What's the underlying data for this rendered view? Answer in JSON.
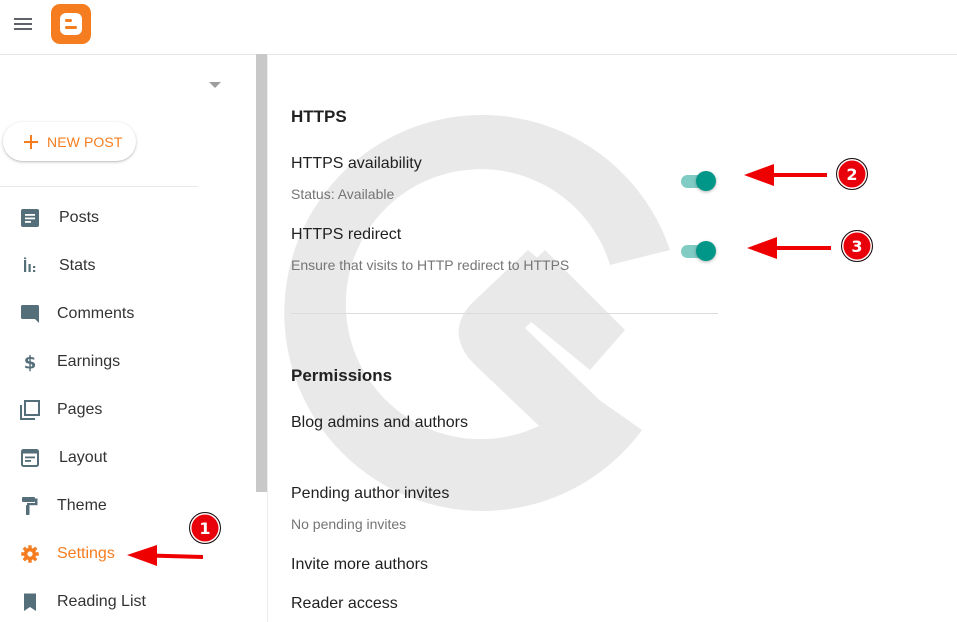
{
  "header": {
    "menu_icon": "hamburger-menu-icon",
    "logo": "blogger-logo",
    "brand_color": "#f57d1f"
  },
  "sidebar": {
    "blog_selector_icon": "caret-down-icon",
    "new_post_label": "NEW POST",
    "items": [
      {
        "label": "Posts",
        "icon": "posts-icon",
        "active": false
      },
      {
        "label": "Stats",
        "icon": "stats-icon",
        "active": false
      },
      {
        "label": "Comments",
        "icon": "comments-icon",
        "active": false
      },
      {
        "label": "Earnings",
        "icon": "dollar-icon",
        "active": false
      },
      {
        "label": "Pages",
        "icon": "pages-icon",
        "active": false
      },
      {
        "label": "Layout",
        "icon": "layout-icon",
        "active": false
      },
      {
        "label": "Theme",
        "icon": "paint-roller-icon",
        "active": false
      },
      {
        "label": "Settings",
        "icon": "gear-icon",
        "active": true
      },
      {
        "label": "Reading List",
        "icon": "bookmark-icon",
        "active": false
      }
    ]
  },
  "main": {
    "https": {
      "heading": "HTTPS",
      "availability": {
        "title": "HTTPS availability",
        "subtitle": "Status: Available",
        "enabled": true
      },
      "redirect": {
        "title": "HTTPS redirect",
        "subtitle": "Ensure that visits to HTTP redirect to HTTPS",
        "enabled": true
      }
    },
    "permissions": {
      "heading": "Permissions",
      "admins_title": "Blog admins and authors",
      "pending_title": "Pending author invites",
      "pending_subtitle": "No pending invites",
      "invite_title": "Invite more authors",
      "reader_access_title": "Reader access"
    }
  },
  "annotations": {
    "badges": [
      "1",
      "2",
      "3"
    ],
    "color": "#e8000a"
  },
  "colors": {
    "toggle_on_thumb": "#009688",
    "toggle_on_track": "#80cbc4",
    "icon_gray": "#546e7a"
  }
}
